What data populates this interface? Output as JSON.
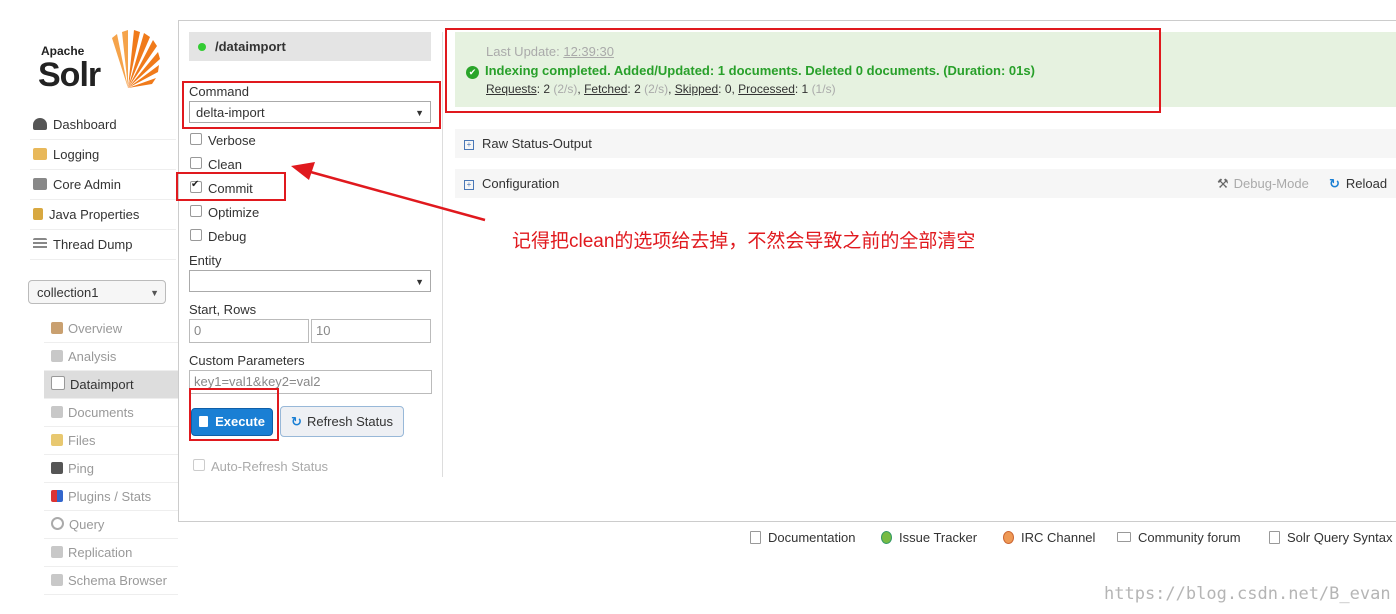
{
  "logo": {
    "line1": "Apache",
    "line2": "Solr"
  },
  "nav": [
    {
      "label": "Dashboard",
      "icon": "dashboard-icon"
    },
    {
      "label": "Logging",
      "icon": "logging-icon"
    },
    {
      "label": "Core Admin",
      "icon": "core-admin-icon"
    },
    {
      "label": "Java Properties",
      "icon": "java-icon"
    },
    {
      "label": "Thread Dump",
      "icon": "thread-dump-icon"
    }
  ],
  "core_selector": {
    "value": "collection1"
  },
  "core_menu": [
    {
      "label": "Overview",
      "icon": "home-icon"
    },
    {
      "label": "Analysis",
      "icon": "filter-icon"
    },
    {
      "label": "Dataimport",
      "icon": "import-icon"
    },
    {
      "label": "Documents",
      "icon": "documents-icon"
    },
    {
      "label": "Files",
      "icon": "files-icon"
    },
    {
      "label": "Ping",
      "icon": "ping-icon"
    },
    {
      "label": "Plugins / Stats",
      "icon": "plugins-icon"
    },
    {
      "label": "Query",
      "icon": "query-icon"
    },
    {
      "label": "Replication",
      "icon": "replication-icon"
    },
    {
      "label": "Schema Browser",
      "icon": "schema-icon"
    }
  ],
  "handler": {
    "name": "/dataimport"
  },
  "form": {
    "command_label": "Command",
    "command_value": "delta-import",
    "verbose": "Verbose",
    "clean": "Clean",
    "commit": "Commit",
    "optimize": "Optimize",
    "debug": "Debug",
    "entity_label": "Entity",
    "start_rows_label": "Start, Rows",
    "start_value": "0",
    "rows_value": "10",
    "custom_label": "Custom Parameters",
    "custom_value": "key1=val1&key2=val2",
    "execute": "Execute",
    "refresh": "Refresh Status",
    "auto_refresh": "Auto-Refresh Status"
  },
  "status": {
    "last_update_label": "Last Update:",
    "last_update_time": "12:39:30",
    "message": "Indexing completed. Added/Updated: 1 documents. Deleted 0 documents. (Duration: 01s)",
    "requests_label": "Requests",
    "requests_value": ": 2 ",
    "requests_rate": "(2/s)",
    "fetched_label": "Fetched",
    "fetched_value": ": 2 ",
    "fetched_rate": "(2/s)",
    "skipped_label": "Skipped",
    "skipped_value": ": 0, ",
    "processed_label": "Processed",
    "processed_value": ": 1 ",
    "processed_rate": "(1/s)"
  },
  "panels": {
    "raw_status": "Raw Status-Output",
    "configuration": "Configuration",
    "debug_mode": "Debug-Mode",
    "reload": "Reload"
  },
  "annotation": "记得把clean的选项给去掉，不然会导致之前的全部清空",
  "footer": [
    {
      "label": "Documentation",
      "icon": "documentation-icon"
    },
    {
      "label": "Issue Tracker",
      "icon": "bug-icon"
    },
    {
      "label": "IRC Channel",
      "icon": "irc-icon"
    },
    {
      "label": "Community forum",
      "icon": "mail-icon"
    },
    {
      "label": "Solr Query Syntax",
      "icon": "syntax-icon"
    }
  ],
  "watermark": "https://blog.csdn.net/B_evan",
  "colors": {
    "accent": "#1a7fd4",
    "success": "#28a02a",
    "annotation": "#e0191e"
  }
}
